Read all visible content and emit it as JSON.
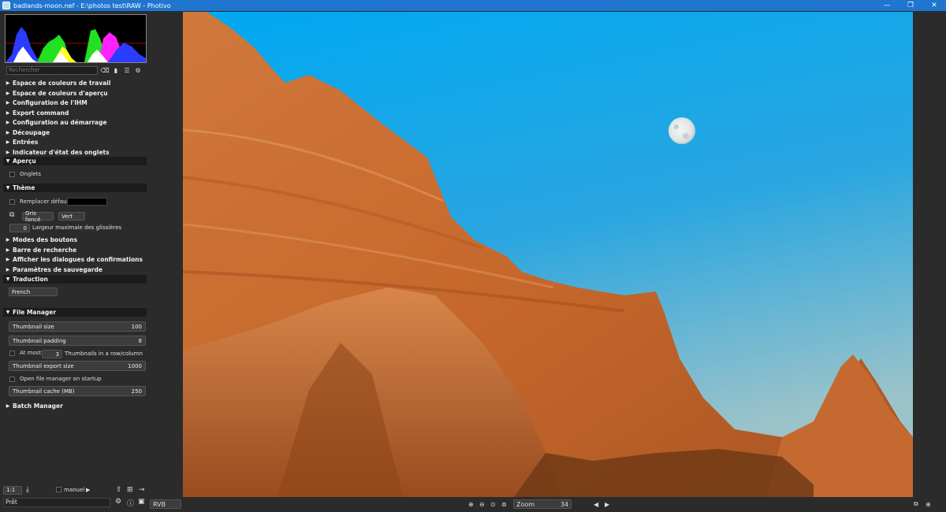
{
  "window": {
    "title": "badlands-moon.nef - E:\\photos test\\RAW - Photivo",
    "min_glyph": "—",
    "max_glyph": "❐",
    "close_glyph": "✕"
  },
  "search": {
    "placeholder": "Rechercher"
  },
  "sections_top": [
    "Espace de couleurs de travail",
    "Espace de couleurs d'aperçu",
    "Configuration de l'IHM",
    "Export command",
    "Configuration au démarrage",
    "Découpage",
    "Entrées",
    "Indicateur d'état des onglets"
  ],
  "apercu": {
    "title": "Aperçu",
    "onglets_label": "Onglets"
  },
  "theme": {
    "title": "Thème",
    "remplacer_label": "Remplacer défaut",
    "theme_value": "Gris foncé",
    "highlight_value": "Vert",
    "slider_width_value": "0",
    "slider_width_label": "Largeur maximale des glissières"
  },
  "sections_mid": [
    "Modes des boutons",
    "Barre de recherche",
    "Afficher les dialogues de confirmations",
    "Paramètres de sauvegarde"
  ],
  "traduction": {
    "title": "Traduction",
    "language": "French"
  },
  "file_manager": {
    "title": "File Manager",
    "thumb_size_label": "Thumbnail size",
    "thumb_size_value": "100",
    "thumb_padding_label": "Thumbnail padding",
    "thumb_padding_value": "8",
    "at_most_label": "At most",
    "at_most_value": "3",
    "thumbs_rowcol_label": "Thumbnails in a row/column",
    "thumb_export_label": "Thumbnail export size",
    "thumb_export_value": "1000",
    "open_fm_label": "Open file manager on startup",
    "thumb_cache_label": "Thumbnail cache (MB)",
    "thumb_cache_value": "250"
  },
  "batch": {
    "title": "Batch Manager"
  },
  "bottom_left": {
    "zoom_ratio": "1:1",
    "manuel_label": "manuel"
  },
  "status": {
    "text": "Prêt"
  },
  "bottom_center": {
    "mode": "RVB",
    "zoom_label": "Zoom",
    "zoom_value": "34"
  }
}
